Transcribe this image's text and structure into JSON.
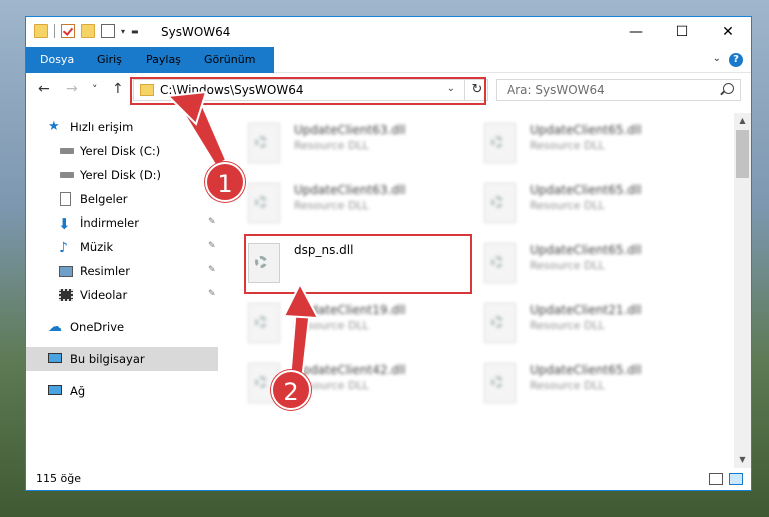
{
  "window": {
    "title": "SysWOW64",
    "minimize": "—",
    "maximize": "☐",
    "close": "✕"
  },
  "ribbon": {
    "tabs": [
      "Dosya",
      "Giriş",
      "Paylaş",
      "Görünüm"
    ],
    "help": "?"
  },
  "nav": {
    "back": "←",
    "forward": "→",
    "recent": "˅",
    "up": "↑"
  },
  "address": {
    "path": "C:\\Windows\\SysWOW64",
    "dropdown": "⌄",
    "refresh": "↻"
  },
  "search": {
    "placeholder": "Ara: SysWOW64"
  },
  "sidebar": {
    "items": [
      {
        "label": "Hızlı erişim",
        "icon": "star-icon"
      },
      {
        "label": "Yerel Disk (C:)",
        "icon": "drive-icon"
      },
      {
        "label": "Yerel Disk (D:)",
        "icon": "drive-icon"
      },
      {
        "label": "Belgeler",
        "icon": "documents-icon"
      },
      {
        "label": "İndirmeler",
        "icon": "download-icon"
      },
      {
        "label": "Müzik",
        "icon": "music-icon"
      },
      {
        "label": "Resimler",
        "icon": "pictures-icon"
      },
      {
        "label": "Videolar",
        "icon": "video-icon"
      },
      {
        "label": "OneDrive",
        "icon": "cloud-icon"
      },
      {
        "label": "Bu bilgisayar",
        "icon": "computer-icon"
      },
      {
        "label": "Ağ",
        "icon": "network-icon"
      }
    ]
  },
  "files": {
    "highlighted": {
      "name": "dsp_ns.dll"
    },
    "blurred": [
      {
        "name": "UpdateClient63.dll",
        "type": "Resource DLL"
      },
      {
        "name": "UpdateClient65.dll",
        "type": "Resource DLL"
      },
      {
        "name": "UpdateClient63.dll",
        "type": "Resource DLL"
      },
      {
        "name": "UpdateClient65.dll",
        "type": "Resource DLL"
      },
      {
        "name": "UpdateClient65.dll",
        "type": "Resource DLL"
      },
      {
        "name": "UpdateClient19.dll",
        "type": "Resource DLL"
      },
      {
        "name": "UpdateClient21.dll",
        "type": "Resource DLL"
      },
      {
        "name": "UpdateClient42.dll",
        "type": "Resource DLL"
      },
      {
        "name": "UpdateClient65.dll",
        "type": "Resource DLL"
      }
    ]
  },
  "status": {
    "count": "115 öğe"
  },
  "annotations": {
    "step1": "1",
    "step2": "2"
  },
  "colors": {
    "accent": "#1979ca",
    "highlight": "#d9383a"
  }
}
